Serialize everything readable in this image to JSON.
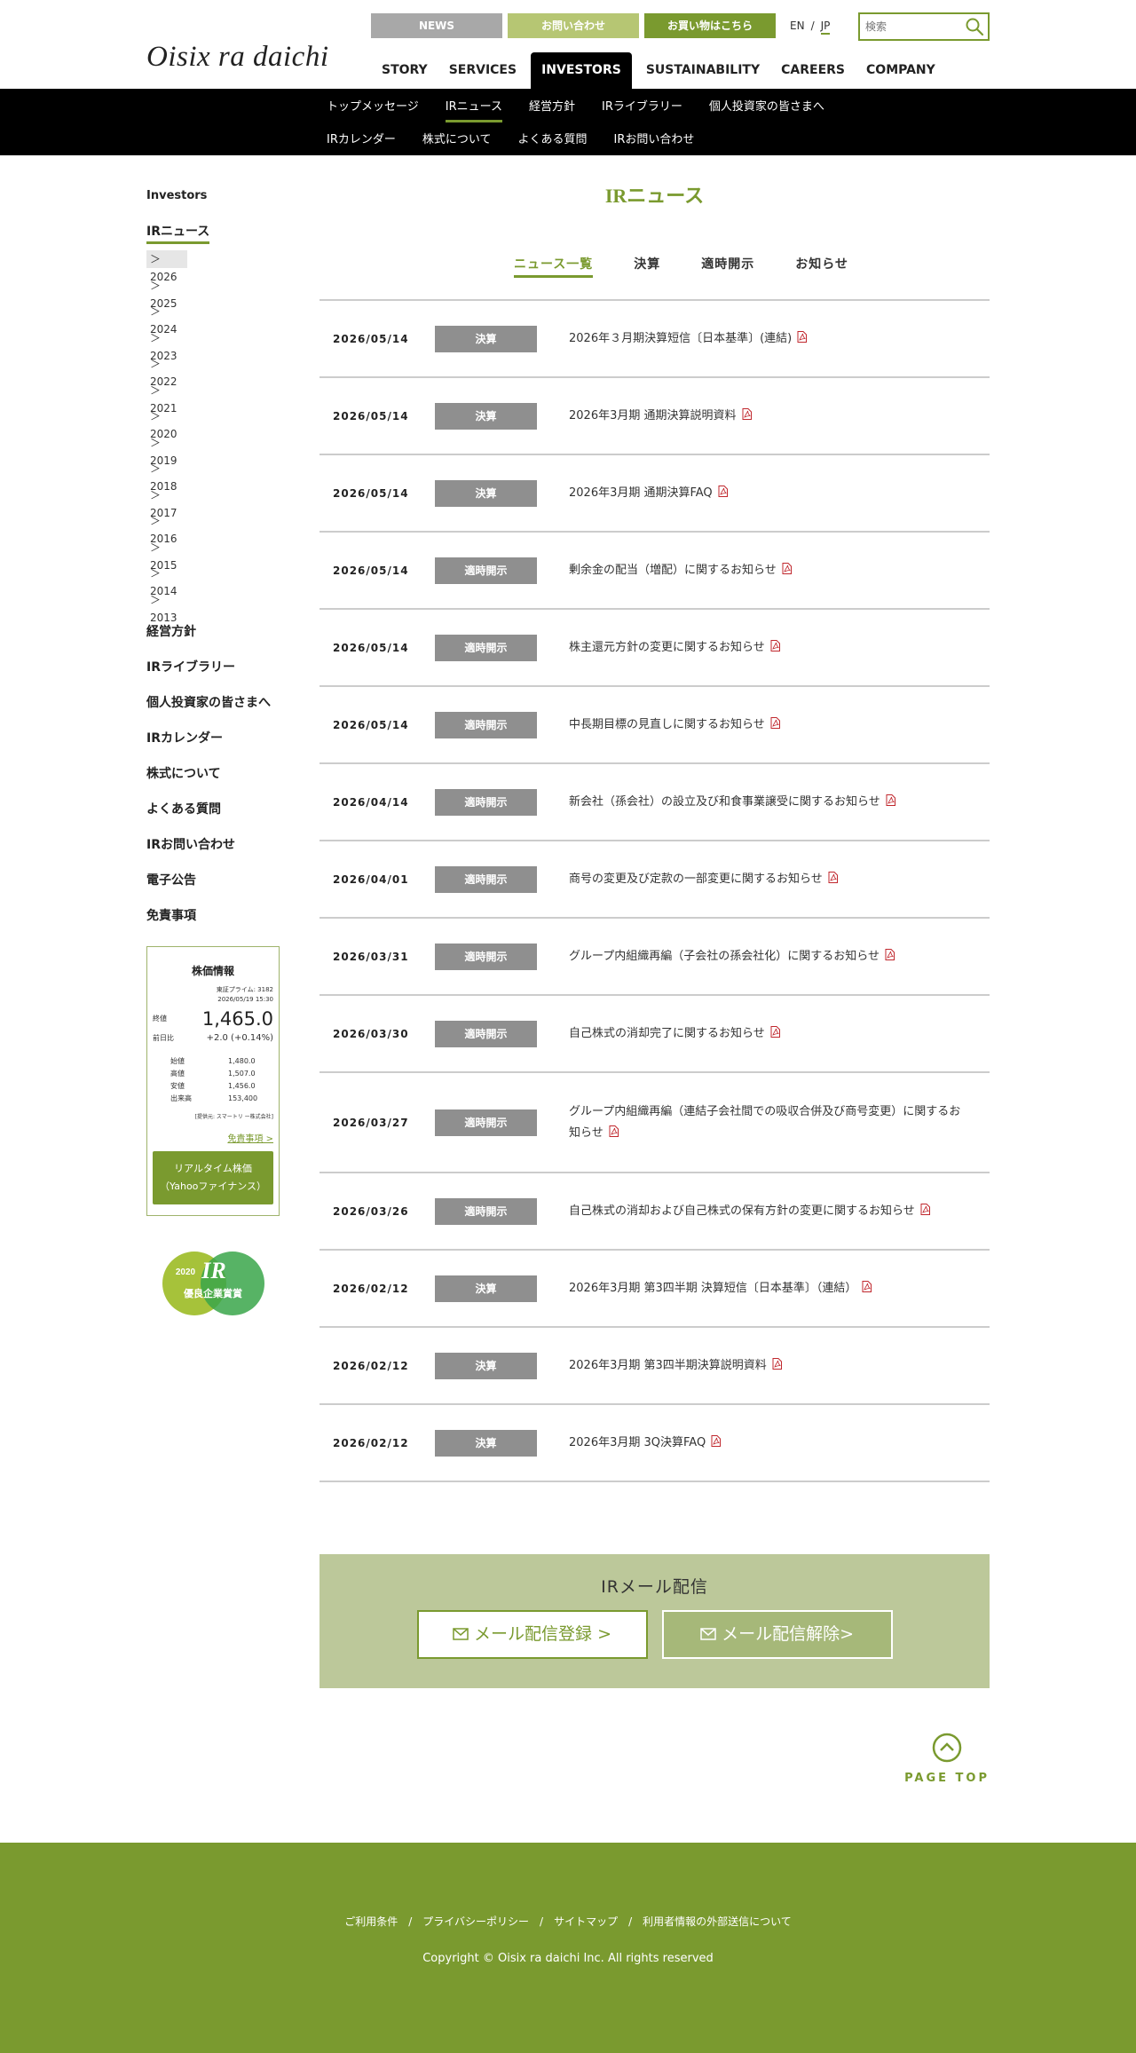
{
  "header": {
    "logo": "Oisix ra daichi",
    "top_buttons": {
      "news": "NEWS",
      "contact": "お問い合わせ",
      "shop": "お買い物はこちら"
    },
    "lang": {
      "en": "EN",
      "sep": "/",
      "jp": "JP"
    },
    "search_placeholder": "検索",
    "nav": [
      "STORY",
      "SERVICES",
      "INVESTORS",
      "SUSTAINABILITY",
      "CAREERS",
      "COMPANY"
    ]
  },
  "subnav": {
    "row1": [
      "トップメッセージ",
      "IRニュース",
      "経営方針",
      "IRライブラリー",
      "個人投資家の皆さまへ"
    ],
    "row2": [
      "IRカレンダー",
      "株式について",
      "よくある質問",
      "IRお問い合わせ"
    ]
  },
  "sidebar": {
    "head": "Investors",
    "current": "IRニュース",
    "years": [
      "＞2026",
      "＞2025",
      "＞2024",
      "＞2023",
      "＞2022",
      "＞2021",
      "＞2020",
      "＞2019",
      "＞2018",
      "＞2017",
      "＞2016",
      "＞2015",
      "＞2014",
      "＞2013"
    ],
    "links": [
      "経営方針",
      "IRライブラリー",
      "個人投資家の皆さまへ",
      "IRカレンダー",
      "株式について",
      "よくある質問",
      "IRお問い合わせ",
      "電子公告",
      "免責事項"
    ]
  },
  "stock": {
    "title": "株価情報",
    "market": "東証プライム: 3182",
    "datetime": "2026/05/19 15:30",
    "close_label": "終値",
    "close": "1,465.0",
    "change_label": "前日比",
    "change": "+2.0 (+0.14%)",
    "open_label": "始値",
    "open": "1,480.0",
    "high_label": "高値",
    "high": "1,507.0",
    "low_label": "安値",
    "low": "1,456.0",
    "volume_label": "出来高",
    "volume": "153,400",
    "note": "[提供元: スマートリ ー株式会社]",
    "disclaimer": "免責事項 >",
    "realtime_line1": "リアルタイム株価",
    "realtime_line2": "（Yahooファイナンス）"
  },
  "award": {
    "year": "2020",
    "text": "優良企業賞賞"
  },
  "main": {
    "title": "IRニュース",
    "tabs": [
      "ニュース一覧",
      "決算",
      "適時開示",
      "お知らせ"
    ],
    "news": [
      {
        "date": "2026/05/14",
        "cat": "決算",
        "title": "2026年３月期決算短信〔日本基準〕(連結)"
      },
      {
        "date": "2026/05/14",
        "cat": "決算",
        "title": "2026年3月期 通期決算説明資料"
      },
      {
        "date": "2026/05/14",
        "cat": "決算",
        "title": "2026年3月期 通期決算FAQ"
      },
      {
        "date": "2026/05/14",
        "cat": "適時開示",
        "title": "剰余金の配当（増配）に関するお知らせ"
      },
      {
        "date": "2026/05/14",
        "cat": "適時開示",
        "title": "株主還元方針の変更に関するお知らせ"
      },
      {
        "date": "2026/05/14",
        "cat": "適時開示",
        "title": "中長期目標の見直しに関するお知らせ"
      },
      {
        "date": "2026/04/14",
        "cat": "適時開示",
        "title": "新会社（孫会社）の設立及び和食事業譲受に関するお知らせ"
      },
      {
        "date": "2026/04/01",
        "cat": "適時開示",
        "title": "商号の変更及び定款の一部変更に関するお知らせ"
      },
      {
        "date": "2026/03/31",
        "cat": "適時開示",
        "title": "グループ内組織再編（子会社の孫会社化）に関するお知らせ"
      },
      {
        "date": "2026/03/30",
        "cat": "適時開示",
        "title": "自己株式の消却完了に関するお知らせ"
      },
      {
        "date": "2026/03/27",
        "cat": "適時開示",
        "title": "グループ内組織再編（連結子会社間での吸収合併及び商号変更）に関するお知らせ"
      },
      {
        "date": "2026/03/26",
        "cat": "適時開示",
        "title": "自己株式の消却および自己株式の保有方針の変更に関するお知らせ"
      },
      {
        "date": "2026/02/12",
        "cat": "決算",
        "title": "2026年3月期 第3四半期 決算短信〔日本基準〕（連結）"
      },
      {
        "date": "2026/02/12",
        "cat": "決算",
        "title": "2026年3月期 第3四半期決算説明資料"
      },
      {
        "date": "2026/02/12",
        "cat": "決算",
        "title": "2026年3月期 3Q決算FAQ"
      }
    ]
  },
  "mail": {
    "title": "IRメール配信",
    "register": "メール配信登録 >",
    "unregister": "メール配信解除>"
  },
  "pagetop": "PAGE TOP",
  "footer": {
    "links": [
      "ご利用条件",
      "プライバシーポリシー",
      "サイトマップ",
      "利用者情報の外部送信について"
    ],
    "copyright": "Copyright © Oisix ra daichi Inc. All rights reserved"
  },
  "colors": {
    "accent": "#7a9a2f",
    "accent_light": "#b6c673",
    "mail_bg": "#bcc89a",
    "category_bg": "#8f8f8f",
    "pdf_red": "#c0272d"
  }
}
